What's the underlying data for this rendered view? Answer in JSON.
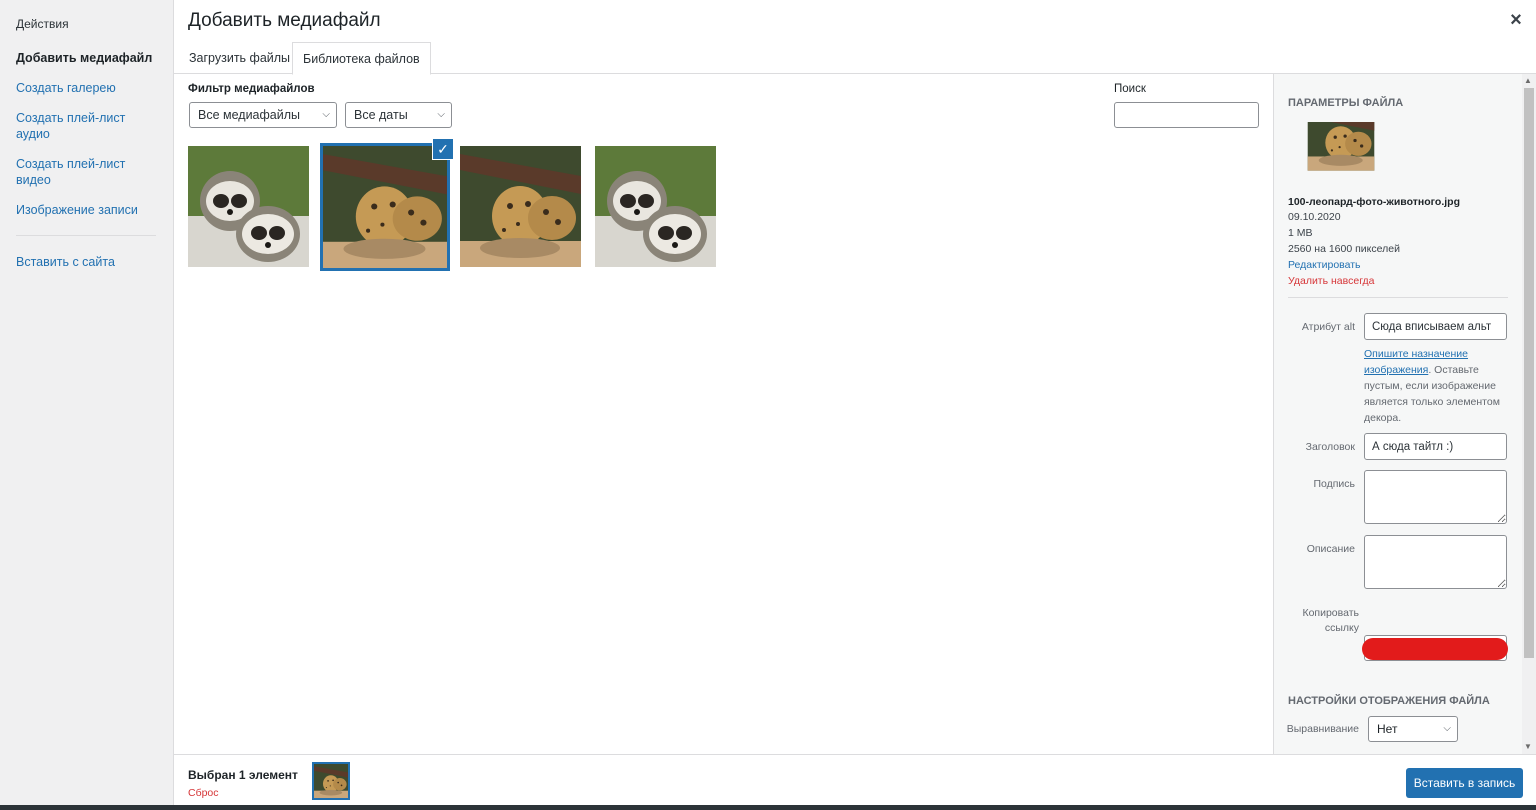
{
  "menu": {
    "title": "Действия",
    "items": [
      {
        "label": "Добавить медиафайл"
      },
      {
        "label": "Создать галерею"
      },
      {
        "label": "Создать плей-лист аудио"
      },
      {
        "label": "Создать плей-лист видео"
      },
      {
        "label": "Изображение записи"
      },
      {
        "label": "Вставить с сайта"
      }
    ]
  },
  "header": {
    "title": "Добавить медиафайл",
    "close_icon": "×"
  },
  "tabs": [
    {
      "label": "Загрузить файлы"
    },
    {
      "label": "Библиотека файлов"
    }
  ],
  "filters": {
    "label": "Фильтр медиафайлов",
    "type_value": "Все медиафайлы",
    "date_value": "Все даты",
    "search_label": "Поиск",
    "search_value": ""
  },
  "thumbnails": [
    {
      "icon": "raccoon-image",
      "selected": false
    },
    {
      "icon": "leopard-image",
      "selected": true
    },
    {
      "icon": "leopard-image",
      "selected": false
    },
    {
      "icon": "raccoon-image",
      "selected": false
    }
  ],
  "details": {
    "heading": "Параметры файла",
    "filename": "100-леопард-фото-животного.jpg",
    "date": "09.10.2020",
    "size": "1 MB",
    "dimensions": "2560 на 1600 пикселей",
    "edit_link": "Редактировать",
    "delete_link": "Удалить навсегда",
    "alt_label": "Атрибут alt",
    "alt_value": "Сюда вписываем альт",
    "help_link": "Опишите назначение изображения",
    "help_text": ". Оставьте пустым, если изображение является только элементом декора.",
    "title_label": "Заголовок",
    "title_value": "А сюда тайтл :)",
    "caption_label": "Подпись",
    "caption_value": "",
    "description_label": "Описание",
    "description_value": "",
    "copy_link_label": "Копировать ссылку"
  },
  "display_settings": {
    "heading": "Настройки отображения файла",
    "align_label": "Выравнивание",
    "align_value": "Нет"
  },
  "footer": {
    "selected_count": "Выбран 1 элемент",
    "reset_label": "Сброс",
    "insert_button": "Вставить в запись"
  },
  "colors": {
    "accent": "#2271b1",
    "danger": "#d63638",
    "redaction": "#e21b1b"
  }
}
